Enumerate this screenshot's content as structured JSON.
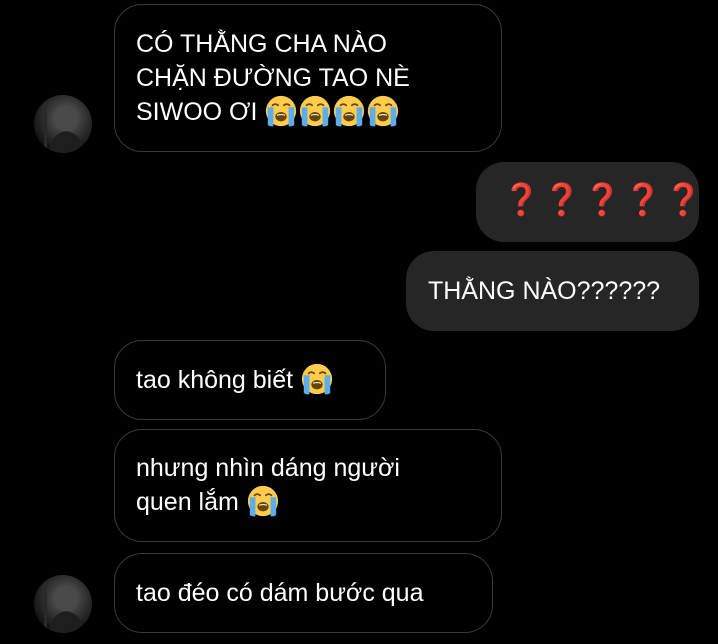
{
  "messages": [
    {
      "id": "m1",
      "direction": "incoming",
      "lines": [
        "CÓ THẰNG CHA NÀO",
        "CHẶN ĐƯỜNG TAO NÈ",
        "SIWOO ƠI"
      ],
      "emoji": [
        "loudly-crying-face",
        "loudly-crying-face",
        "loudly-crying-face",
        "loudly-crying-face"
      ]
    },
    {
      "id": "m2",
      "direction": "outgoing",
      "text": "❓❓❓❓❓"
    },
    {
      "id": "m3",
      "direction": "outgoing",
      "text": "THẰNG NÀO??????"
    },
    {
      "id": "m4",
      "direction": "incoming",
      "text": "tao không biết",
      "emoji": [
        "loudly-crying-face"
      ]
    },
    {
      "id": "m5",
      "direction": "incoming",
      "lines": [
        "nhưng nhìn dáng người",
        "quen lắm"
      ],
      "emoji": [
        "loudly-crying-face"
      ]
    },
    {
      "id": "m6",
      "direction": "incoming",
      "text": "tao đéo có dám bước qua"
    }
  ],
  "question_mark_color": "#e1262d",
  "outgoing_bubble_color": "#262626",
  "incoming_border_color": "#3a3a3a"
}
